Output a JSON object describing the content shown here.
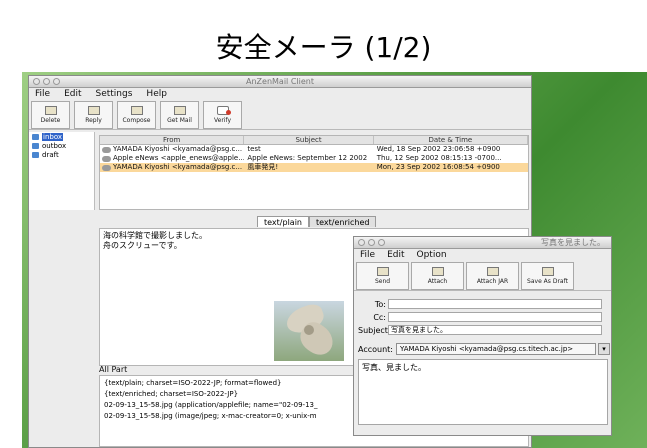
{
  "slide": {
    "title": "安全メーラ (1/2)"
  },
  "main_window": {
    "title": "AnZenMail Client",
    "menu": [
      "File",
      "Edit",
      "Settings",
      "Help"
    ],
    "toolbar": [
      "Delete",
      "Reply",
      "Compose",
      "Get Mail",
      "Verify"
    ],
    "folders": [
      "inbox",
      "outbox",
      "draft"
    ],
    "columns": [
      "From",
      "Subject",
      "Date & Time"
    ],
    "messages": [
      {
        "from": "YAMADA Kiyoshi <kyamada@psg.c...",
        "subject": "test",
        "date": "Wed, 18 Sep 2002 23:06:58 +0900"
      },
      {
        "from": "Apple eNews <apple_enews@apple...",
        "subject": "Apple eNews: September 12 2002",
        "date": "Thu, 12 Sep 2002 08:15:13 -0700..."
      },
      {
        "from": "YAMADA Kiyoshi <kyamada@psg.c...",
        "subject": "風車発見!",
        "date": "Mon, 23 Sep 2002 16:08:54 +0900"
      }
    ],
    "tabs": [
      "text/plain",
      "text/enriched"
    ],
    "body_lines": [
      "海の科学館で撮影しました。",
      "舟のスクリューです。"
    ],
    "all_part_label": "All Part",
    "parts": [
      "{text/plain;  charset=ISO-2022-JP;  format=flowed}",
      "{text/enriched;  charset=ISO-2022-JP}",
      "02-09-13_15-58.jpg (application/applefile;  name=\"02-09-13_",
      "02-09-13_15-58.jpg (image/jpeg;  x-mac-creator=0;  x-unix-m"
    ]
  },
  "compose_window": {
    "title": "写真を見ました。",
    "menu": [
      "File",
      "Edit",
      "Option"
    ],
    "toolbar": [
      "Send",
      "Attach",
      "Attach JAR",
      "Save As Draft"
    ],
    "to_label": "To:",
    "cc_label": "Cc:",
    "subject_label": "Subject:",
    "subject_value": "写真を見ました。",
    "account_label": "Account:",
    "account_value": "YAMADA Kiyoshi <kyamada@psg.cs.titech.ac.jp>",
    "body": "写真、見ました。"
  }
}
